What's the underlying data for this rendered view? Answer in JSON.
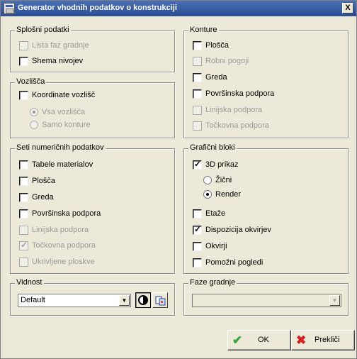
{
  "window": {
    "title": "Generator vhodnih podatkov o konstrukciji",
    "close_glyph": "X"
  },
  "splosni": {
    "legend": "Splošni podatki",
    "items": [
      {
        "label": "Lista faz gradnje",
        "checked": false,
        "enabled": false
      },
      {
        "label": "Shema nivojev",
        "checked": false,
        "enabled": true
      }
    ]
  },
  "vozlisca": {
    "legend": "Vozlišča",
    "checkbox": {
      "label": "Koordinate vozlišč",
      "checked": false,
      "enabled": true
    },
    "radios": [
      {
        "label": "Vsa vozlišča",
        "selected": true,
        "enabled": false
      },
      {
        "label": "Samo konture",
        "selected": false,
        "enabled": false
      }
    ]
  },
  "seti": {
    "legend": "Seti numeričnih podatkov",
    "items": [
      {
        "label": "Tabele materialov",
        "checked": false,
        "enabled": true
      },
      {
        "label": "Plošča",
        "checked": false,
        "enabled": true
      },
      {
        "label": "Greda",
        "checked": false,
        "enabled": true
      },
      {
        "label": "Površinska podpora",
        "checked": false,
        "enabled": true
      },
      {
        "label": "Linijska podpora",
        "checked": false,
        "enabled": false
      },
      {
        "label": "Točkovna podpora",
        "checked": true,
        "enabled": false
      },
      {
        "label": "Ukrivljene ploskve",
        "checked": false,
        "enabled": false
      }
    ]
  },
  "konture": {
    "legend": "Konture",
    "items": [
      {
        "label": "Plošča",
        "checked": false,
        "enabled": true
      },
      {
        "label": "Robni pogoji",
        "checked": false,
        "enabled": false
      },
      {
        "label": "Greda",
        "checked": false,
        "enabled": true
      },
      {
        "label": "Površinska podpora",
        "checked": false,
        "enabled": true
      },
      {
        "label": "Linijska podpora",
        "checked": false,
        "enabled": false
      },
      {
        "label": "Točkovna podpora",
        "checked": false,
        "enabled": false
      }
    ]
  },
  "graficni": {
    "legend": "Grafični bloki",
    "prikaz_3d": {
      "label": "3D prikaz",
      "checked": true,
      "enabled": true
    },
    "radios": [
      {
        "label": "Žični",
        "selected": false,
        "enabled": true
      },
      {
        "label": "Render",
        "selected": true,
        "enabled": true
      }
    ],
    "items": [
      {
        "label": "Etaže",
        "checked": false,
        "enabled": true
      },
      {
        "label": "Dispozicija okvirjev",
        "checked": true,
        "enabled": true
      },
      {
        "label": "Okvirji",
        "checked": false,
        "enabled": true
      },
      {
        "label": "Pomožni pogledi",
        "checked": false,
        "enabled": true
      }
    ]
  },
  "vidnost": {
    "legend": "Vidnost",
    "selected": "Default",
    "dropdown_glyph": "▼",
    "contrast_icon": "contrast-icon",
    "layers_icon": "layers-icon"
  },
  "faze": {
    "legend": "Faze gradnje",
    "selected": "",
    "dropdown_glyph": "▼"
  },
  "buttons": {
    "ok_label": "OK",
    "ok_glyph": "✔",
    "ok_color": "#3aa63a",
    "cancel_label": "Prekliči",
    "cancel_glyph": "✖",
    "cancel_color": "#d32020"
  }
}
